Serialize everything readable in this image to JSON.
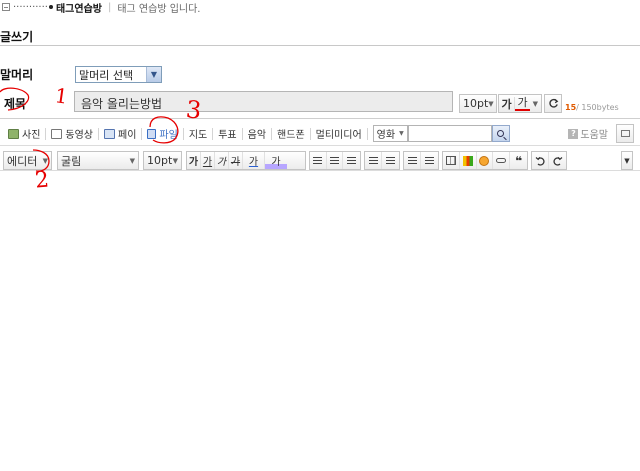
{
  "breadcrumb": {
    "dots": "···········",
    "cafe_name": "태그연습방",
    "separator": "|",
    "description": "태그 연습방 입니다."
  },
  "section_title": "글쓰기",
  "header_field": {
    "label": "말머리",
    "selected": "말머리 선택"
  },
  "subject_field": {
    "label": "제목",
    "value": "음악 올리는방법",
    "font_size": "10pt",
    "bold_label": "가",
    "color_label": "가",
    "byte_count": "15",
    "byte_limit": "/ 150bytes"
  },
  "attach_toolbar": {
    "items": [
      "사진",
      "동영상",
      "페이",
      "파일",
      "지도",
      "투표",
      "음악",
      "핸드폰",
      "멀티미디어"
    ],
    "search_category": "영화",
    "help_label": "도움말"
  },
  "editor_toolbar": {
    "mode": "에디터",
    "font_name": "굴림",
    "font_size": "10pt",
    "format_labels": [
      "가",
      "가",
      "가",
      "가",
      "가",
      "가"
    ]
  },
  "annotations": [
    "1",
    "2",
    "3"
  ],
  "colors": {
    "accent_blue": "#3a6fc4",
    "annotation_red": "#e60000",
    "byte_orange": "#e05a00"
  }
}
